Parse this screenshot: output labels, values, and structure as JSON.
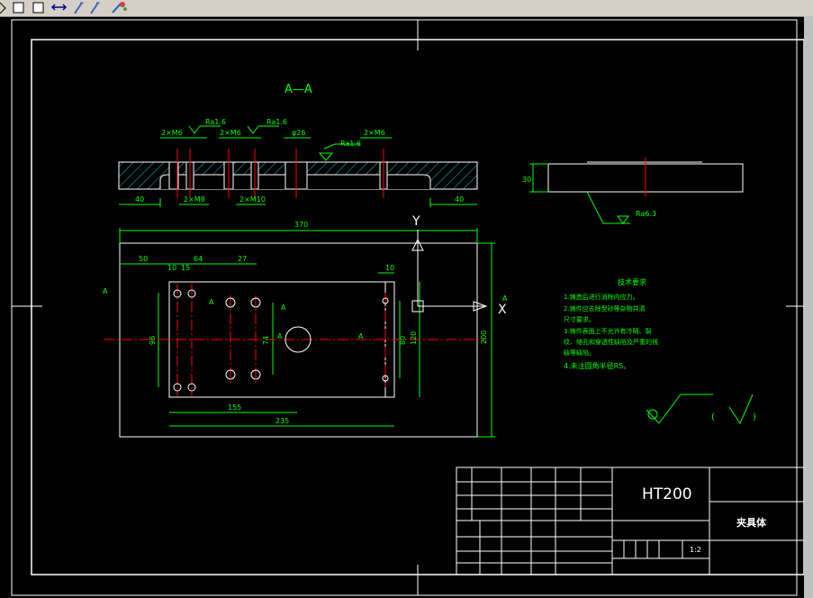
{
  "toolbar": {
    "buttons": [
      "cursor-tool",
      "rectangle-tool",
      "square-tool",
      "move-tool",
      "pen-tool",
      "pen-tool-2",
      "paint-tool"
    ]
  },
  "drawing": {
    "section_title": "A—A",
    "roughness_labels": [
      "Ra1.6",
      "Ra1.6",
      "Ra1.6",
      "Ra6.3"
    ],
    "top_callouts": [
      "2×M6",
      "2×M6",
      "φ26",
      "2×M6"
    ],
    "section_bottom_callouts": [
      "40",
      "2×M8",
      "2×M10",
      "40"
    ],
    "side_view_height": "30",
    "axis_y": "Y",
    "axis_x": "X",
    "dims": {
      "overall_width": "370",
      "overall_height": "200",
      "d50": "50",
      "d10": "10",
      "d15": "15",
      "d64": "64",
      "d27": "27",
      "d10b": "10",
      "d96": "96",
      "d74": "74",
      "d80": "80",
      "d120": "120",
      "d155": "155",
      "d235": "235"
    },
    "section_marks": [
      "A",
      "A",
      "A",
      "A",
      "A",
      "A"
    ],
    "tech_req_title": "技术要求",
    "tech_req_lines": [
      "1.铸造后进行消除内应力。",
      "2.铸件应去除型砂等杂物并清",
      "尺寸要求。",
      "3.铸件表面上不允许有冷隔、裂",
      "纹、缩孔和穿透性缺陷及严重的残",
      "缺等缺陷。",
      "4.未注圆角半径R5。"
    ],
    "roughness_open_paren": "(",
    "roughness_close_paren": ")"
  },
  "title_block": {
    "material": "HT200",
    "part_name": "夹具体",
    "scale": "1:2"
  },
  "colors": {
    "line": "#ffffff",
    "dim": "#00ff00",
    "hatch": "#00c8c8",
    "center": "#ff0000"
  }
}
